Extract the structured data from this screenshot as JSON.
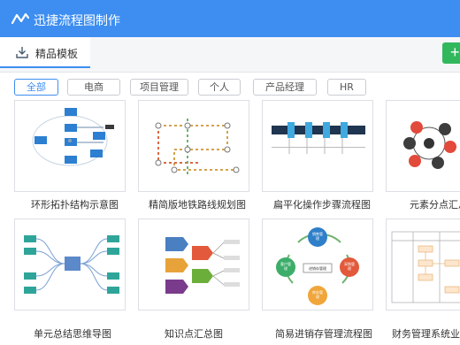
{
  "titlebar": {
    "title": "迅捷流程图制作",
    "icon": "zigzag-logo-icon"
  },
  "tabs": {
    "templates_label": "精品模板",
    "templates_icon": "download-icon",
    "add_icon": "plus-icon"
  },
  "filters": [
    "全部",
    "电商",
    "项目管理",
    "个人",
    "产品经理",
    "HR"
  ],
  "active_filter": "全部",
  "templates": [
    {
      "label": "环形拓扑结构示意图"
    },
    {
      "label": "精简版地铁路线规划图"
    },
    {
      "label": "扁平化操作步骤流程图"
    },
    {
      "label": "元素分点汇总"
    },
    {
      "label": "单元总结思维导图"
    },
    {
      "label": "知识点汇总图"
    },
    {
      "label": "简易进销存管理流程图"
    },
    {
      "label": "财务管理系统业务"
    }
  ],
  "thumb_text": {
    "jxc": [
      "销售管理",
      "采购管理",
      "库存管理",
      "进销存管理",
      "财务管理",
      "客户管理"
    ]
  },
  "colors": {
    "accent": "#3d8ef0",
    "add_button": "#31b85c"
  }
}
